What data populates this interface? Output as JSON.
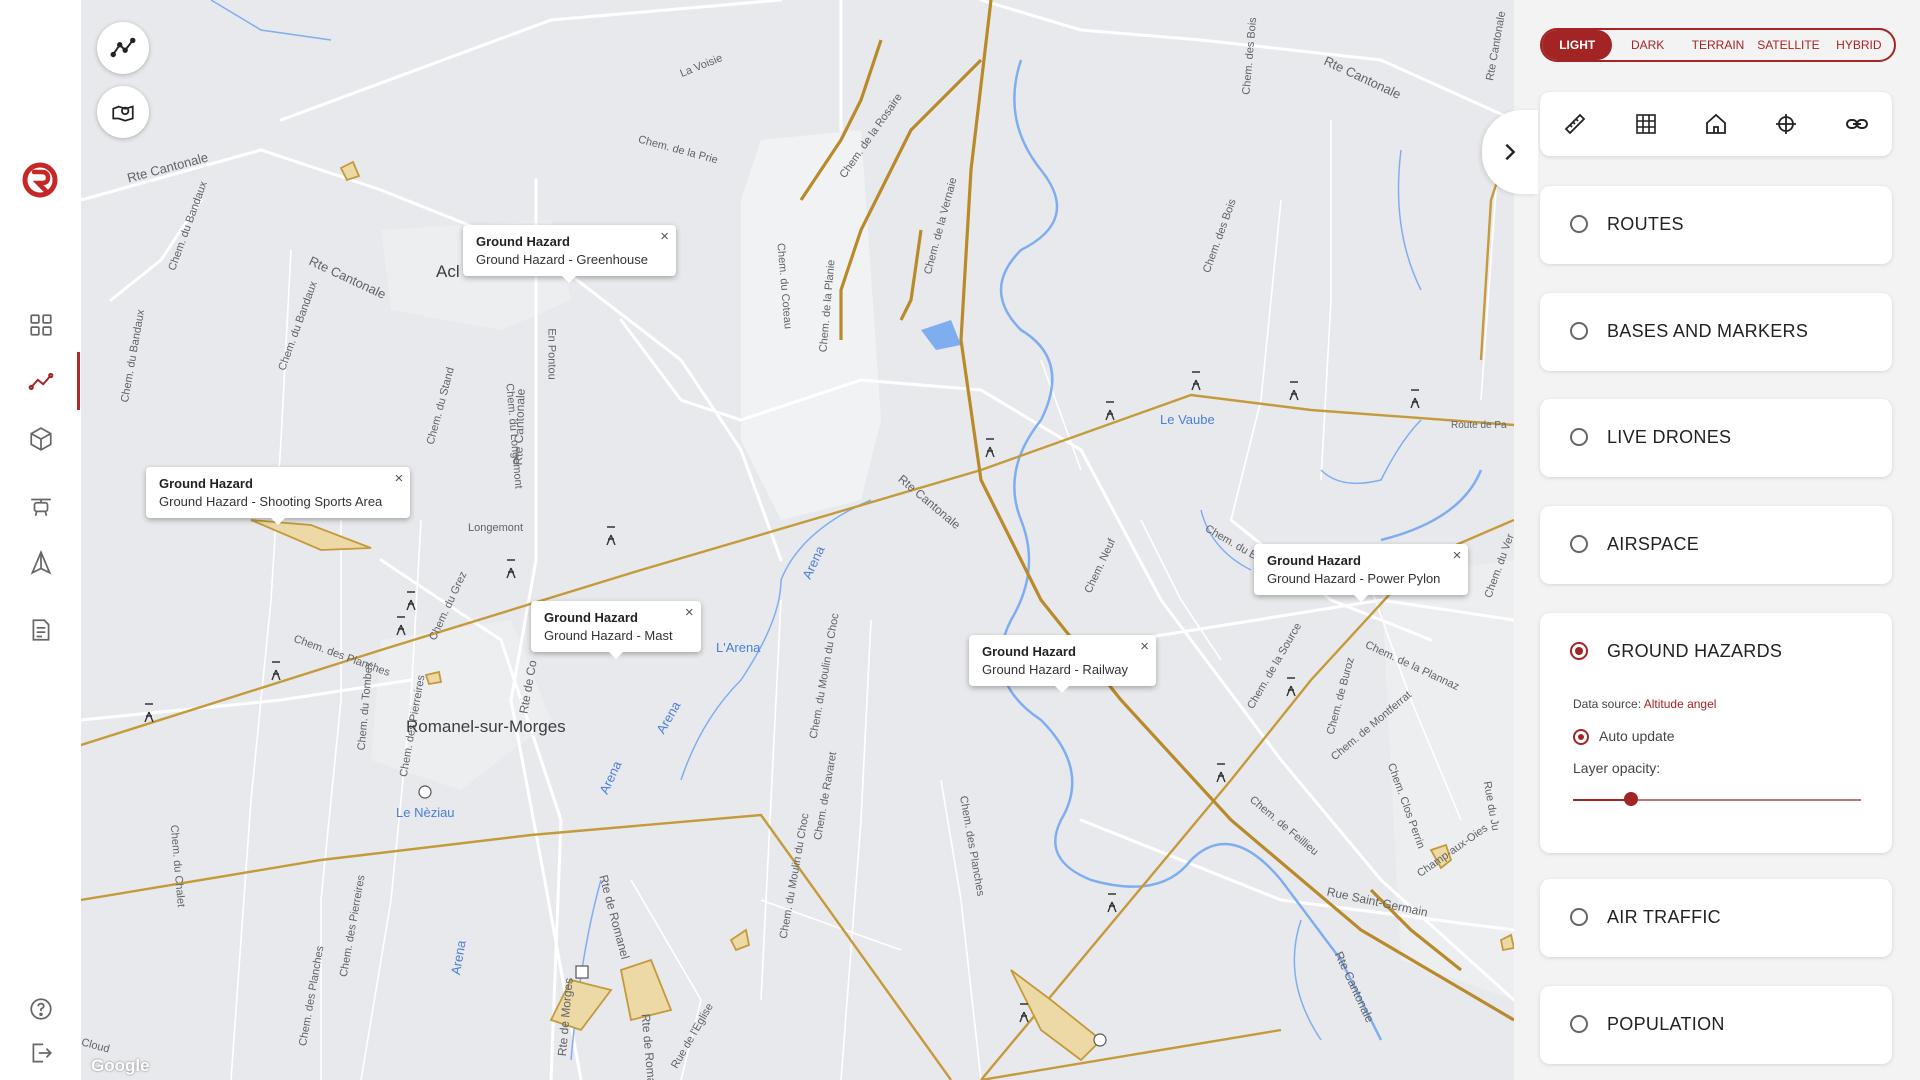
{
  "nav": {
    "items": [
      "dashboard-icon",
      "routes-icon",
      "cube-icon",
      "drone-icon",
      "airspace-icon",
      "document-icon"
    ],
    "bottom": [
      "help-icon",
      "logout-icon"
    ]
  },
  "map": {
    "place_labels": [
      {
        "text": "La Voisie"
      },
      {
        "text": "Rte Cantonale"
      },
      {
        "text": "Rte Cantonale"
      },
      {
        "text": "Rte Cantonale"
      },
      {
        "text": "Chem. de la Prie"
      },
      {
        "text": "Chem. du Bandaux"
      },
      {
        "text": "Chem. du Bandaux"
      },
      {
        "text": "Chem. du Bandaux"
      },
      {
        "text": "Acl"
      },
      {
        "text": "En Pontou"
      },
      {
        "text": "Rte Cantonale"
      },
      {
        "text": "Chem. du Stand"
      },
      {
        "text": "Chem. du Longemont"
      },
      {
        "text": "Longemont"
      },
      {
        "text": "Le Vaube"
      },
      {
        "text": "Route de Pa"
      },
      {
        "text": "Rte Cantonale"
      },
      {
        "text": "Chem. des Bois"
      },
      {
        "text": "Chem. des Bois"
      },
      {
        "text": "Chem. de la Planie"
      },
      {
        "text": "Chem. du Coteau"
      },
      {
        "text": "Chem. de la Vernaie"
      },
      {
        "text": "Chem. de la Rosaire"
      },
      {
        "text": "Chem. des Planches"
      },
      {
        "text": "Chem. du Tombex"
      },
      {
        "text": "Chem. des Pierreires"
      },
      {
        "text": "Chem. du Grez"
      },
      {
        "text": "Rte de Co"
      },
      {
        "text": "Chem. du Moulin du Choc"
      },
      {
        "text": "Chem. de Ravaret"
      },
      {
        "text": "Chem. des Planches"
      },
      {
        "text": "Chem. Neuf"
      },
      {
        "text": "Chem. du Bois"
      },
      {
        "text": "Chem. de la Source"
      },
      {
        "text": "Chem. de Buroz"
      },
      {
        "text": "Chem. de la Plannaz"
      },
      {
        "text": "Chem. de Montferrat"
      },
      {
        "text": "Chem. de Feillieu"
      },
      {
        "text": "Chem. Clos Perrin"
      },
      {
        "text": "Champ-aux-Oies"
      },
      {
        "text": "Rue Saint-Germain"
      },
      {
        "text": "Rte Cantonale"
      },
      {
        "text": "Chem. du Chalet"
      },
      {
        "text": "Chem. des Pierreires"
      },
      {
        "text": "Chem. des Planches"
      },
      {
        "text": "Rte de Romanel"
      },
      {
        "text": "Rte de Morges"
      },
      {
        "text": "Rte de Romanel"
      },
      {
        "text": "Rue de l'Eglise"
      },
      {
        "text": "Chem. du Moulin du Choc"
      },
      {
        "text": "Rue du Ju"
      },
      {
        "text": "Chem. du Ver"
      },
      {
        "text": "Cloud"
      },
      {
        "text": "Rte Cantonale"
      }
    ],
    "towns": [
      {
        "text": "Romanel-sur-Morges"
      }
    ],
    "water_labels": [
      {
        "text": "Le Nèziau"
      },
      {
        "text": "L'Arena"
      },
      {
        "text": "Arena"
      },
      {
        "text": "Arena"
      },
      {
        "text": "Arena"
      },
      {
        "text": "Arena"
      }
    ],
    "popups": [
      {
        "title": "Ground Hazard",
        "subtitle": "Ground Hazard - Greenhouse"
      },
      {
        "title": "Ground Hazard",
        "subtitle": "Ground Hazard - Shooting Sports Area"
      },
      {
        "title": "Ground Hazard",
        "subtitle": "Ground Hazard - Mast"
      },
      {
        "title": "Ground Hazard",
        "subtitle": "Ground Hazard - Railway"
      },
      {
        "title": "Ground Hazard",
        "subtitle": "Ground Hazard - Power Pylon"
      }
    ],
    "close_glyph": "×",
    "google": "Google",
    "hazard_color": "#c49a3a"
  },
  "panel": {
    "map_types": [
      {
        "label": "LIGHT",
        "active": true
      },
      {
        "label": "DARK"
      },
      {
        "label": "TERRAIN"
      },
      {
        "label": "SATELLITE"
      },
      {
        "label": "HYBRID"
      }
    ],
    "tools": [
      "ruler-icon",
      "grid-icon",
      "home-icon",
      "crosshair-icon",
      "link-icon"
    ],
    "layers": [
      {
        "label": "ROUTES",
        "checked": false
      },
      {
        "label": "BASES AND MARKERS",
        "checked": false
      },
      {
        "label": "LIVE DRONES",
        "checked": false
      },
      {
        "label": "AIRSPACE",
        "checked": false
      },
      {
        "label": "GROUND HAZARDS",
        "checked": true
      },
      {
        "label": "AIR TRAFFIC",
        "checked": false
      },
      {
        "label": "POPULATION",
        "checked": false
      }
    ],
    "ground_hazards": {
      "data_source_label": "Data source:",
      "data_source_value": "Altitude angel",
      "auto_update": "Auto update",
      "layer_opacity": "Layer opacity:",
      "opacity_value": 0.2
    },
    "accent": "#a32424"
  }
}
